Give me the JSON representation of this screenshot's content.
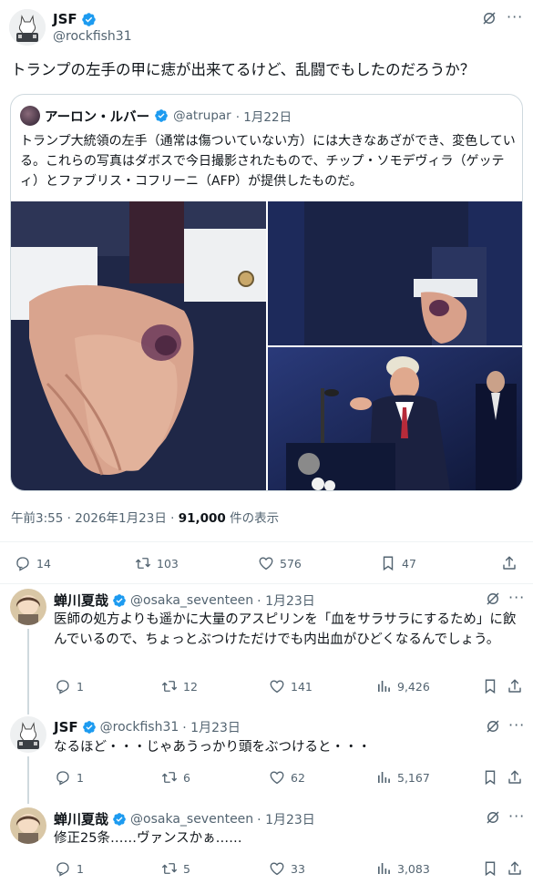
{
  "main_tweet": {
    "name": "JSF",
    "handle": "@rockfish31",
    "text": "トランプの左手の甲に痣が出来てるけど、乱闘でもしたのだろうか？",
    "meta_time": "午前3:55 · 2026年1月23日 · ",
    "meta_views": "91,000",
    "meta_views_suffix": " 件の表示",
    "stats": {
      "replies": "14",
      "retweets": "103",
      "likes": "576",
      "bookmarks": "47"
    }
  },
  "quoted_tweet": {
    "name": "アーロン・ルバー",
    "handle": "@atrupar",
    "date": "· 1月22日",
    "text": "トランプ大統領の左手（通常は傷ついていない方）には大きなあざができ、変色している。これらの写真はダボスで今日撮影されたもので、チップ・ソモデヴィラ（ゲッティ）とファブリス・コフリーニ（AFP）が提供したものだ。"
  },
  "replies": [
    {
      "name": "蝉川夏哉",
      "handle": "@osaka_seventeen",
      "date": "· 1月23日",
      "text": "医師の処方よりも遥かに大量のアスピリンを「血をサラサラにするため」に飲んでいるので、ちょっとぶつけただけでも内出血がひどくなるんでしょう。",
      "stats": {
        "replies": "1",
        "retweets": "12",
        "likes": "141",
        "views": "9,426"
      }
    },
    {
      "name": "JSF",
      "handle": "@rockfish31",
      "date": "· 1月23日",
      "text": "なるほど・・・じゃあうっかり頭をぶつけると・・・",
      "stats": {
        "replies": "1",
        "retweets": "6",
        "likes": "62",
        "views": "5,167"
      }
    },
    {
      "name": "蝉川夏哉",
      "handle": "@osaka_seventeen",
      "date": "· 1月23日",
      "text": "修正25条……ヴァンスかぁ……",
      "stats": {
        "replies": "1",
        "retweets": "5",
        "likes": "33",
        "views": "3,083"
      }
    }
  ],
  "colors": {
    "accent": "#1d9bf0",
    "text": "#0f1419",
    "secondary": "#536471",
    "border": "#cfd9de"
  }
}
